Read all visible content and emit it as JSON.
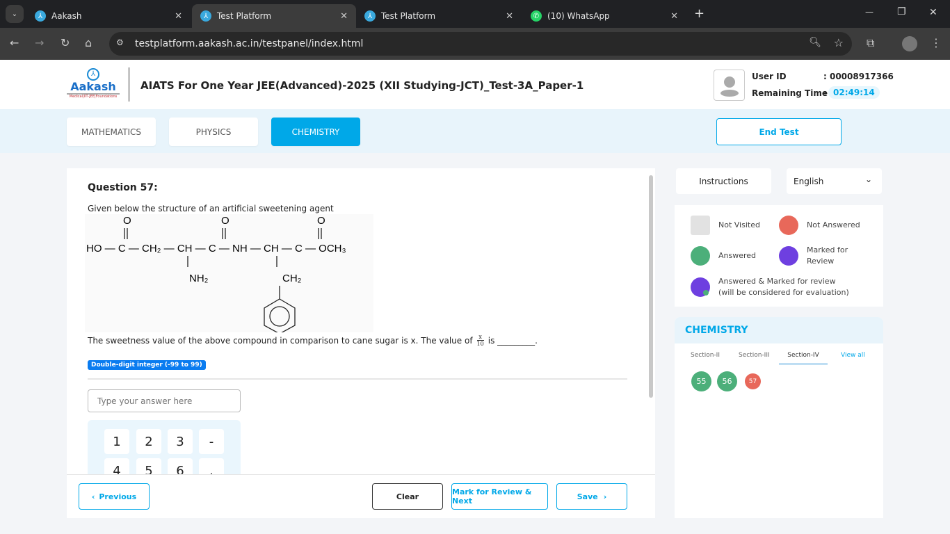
{
  "browser": {
    "tabs": [
      {
        "title": "Aakash",
        "active": false
      },
      {
        "title": "Test Platform",
        "active": true
      },
      {
        "title": "Test Platform",
        "active": false
      },
      {
        "title": "(10) WhatsApp",
        "active": false
      }
    ],
    "url": "testplatform.aakash.ac.in/testpanel/index.html"
  },
  "header": {
    "logo_text": "Aakash",
    "logo_sub": "Medical|IIT-JEE|Foundations",
    "title": "AIATS For One Year JEE(Advanced)-2025 (XII Studying-JCT)_Test-3A_Paper-1",
    "user_id_label": "User ID",
    "user_id": ": 00008917366",
    "time_label": "Remaining Time",
    ":": ":",
    "remaining_time": "02:49:14"
  },
  "subjects": [
    {
      "label": "MATHEMATICS",
      "active": false
    },
    {
      "label": "PHYSICS",
      "active": false
    },
    {
      "label": "CHEMISTRY",
      "active": true
    }
  ],
  "end_test": "End Test",
  "question": {
    "number": "Question 57:",
    "intro": "Given below the structure of an artificial sweetening agent",
    "structure": {
      "main": "HO — C — CH₂ — CH — C — NH — CH — C — OCH₃",
      "o": "O",
      "nh2": "NH₂",
      "ch2": "CH₂"
    },
    "text": "The sweetness value of the above compound in comparison to cane sugar is x. The value of",
    "frac_num": "x",
    "frac_den": "10",
    "text_end": "is _________.",
    "type_badge": "Double-digit integer (-99 to 99)",
    "answer_placeholder": "Type your answer here",
    "answer_value": "",
    "keypad": [
      "1",
      "2",
      "3",
      "-",
      "4",
      "5",
      "6",
      "."
    ]
  },
  "footer": {
    "previous": "Previous",
    "clear": "Clear",
    "mark_review": "Mark for Review & Next",
    "save": "Save"
  },
  "right": {
    "instructions": "Instructions",
    "language": "English",
    "legend": [
      {
        "label": "Not Visited",
        "color": "#e2e2e2"
      },
      {
        "label": "Not Answered",
        "color": "#e8685a"
      },
      {
        "label": "Answered",
        "color": "#4caf7a"
      },
      {
        "label": "Marked for Review",
        "color": "#6e3fe0"
      },
      {
        "label": "Answered & Marked for review",
        "sub": "(will be considered for evaluation)",
        "color": "#6e3fe0"
      }
    ],
    "subject": "CHEMISTRY",
    "sections": [
      {
        "label": "Section-II",
        "active": false
      },
      {
        "label": "Section-III",
        "active": false
      },
      {
        "label": "Section-IV",
        "active": true
      }
    ],
    "view_all": "View all",
    "questions": [
      {
        "n": "55",
        "status": "answered"
      },
      {
        "n": "56",
        "status": "answered"
      },
      {
        "n": "57",
        "status": "not-answered"
      }
    ]
  },
  "colors": {
    "accent": "#00a8e8",
    "answered": "#4caf7a",
    "not_answered": "#e8685a",
    "marked": "#6e3fe0"
  }
}
